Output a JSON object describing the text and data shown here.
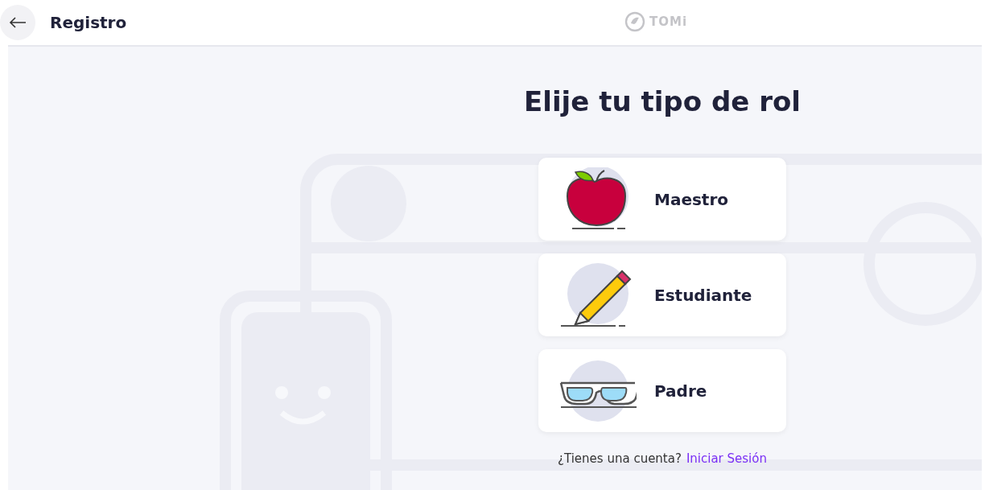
{
  "header": {
    "title": "Registro",
    "logo_text": "TOMi"
  },
  "heading": "Elije tu tipo de rol",
  "roles": [
    {
      "kind": "apple",
      "label": "Maestro"
    },
    {
      "kind": "pencil",
      "label": "Estudiante"
    },
    {
      "kind": "glasses",
      "label": "Padre"
    }
  ],
  "footer": {
    "question": "¿Tienes una cuenta?",
    "link": "Iniciar Sesión"
  }
}
